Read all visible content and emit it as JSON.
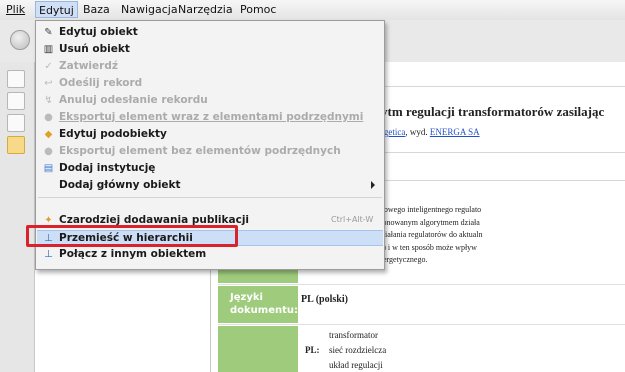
{
  "menubar": {
    "items": [
      "Plik",
      "Edytuj",
      "Baza",
      "Nawigacja",
      "Narzędzia",
      "Pomoc"
    ],
    "active": "Edytuj"
  },
  "edit_menu": {
    "items": [
      {
        "label": "Edytuj obiekt",
        "icon": "edit-icon",
        "enabled": true
      },
      {
        "label": "Usuń obiekt",
        "icon": "trash-icon",
        "enabled": true
      },
      {
        "label": "Zatwierdź",
        "icon": "check-icon",
        "enabled": false
      },
      {
        "label": "Odeślij rekord",
        "icon": "return-icon",
        "enabled": false
      },
      {
        "label": "Anuluj odesłanie rekordu",
        "icon": "cancel-return-icon",
        "enabled": false
      },
      {
        "label": "Eksportuj element wraz z elementami podrzędnymi",
        "icon": "export-icon",
        "enabled": false
      },
      {
        "label": "Edytuj podobiekty",
        "icon": "edit-children-icon",
        "enabled": true
      },
      {
        "label": "Eksportuj element bez elementów podrzędnych",
        "icon": "export-icon",
        "enabled": false
      },
      {
        "label": "Dodaj instytucję",
        "icon": "institution-icon",
        "enabled": true
      },
      {
        "label": "Dodaj główny obiekt",
        "icon": "none",
        "enabled": true,
        "submenu": true
      },
      {
        "label": "Czarodziej dodawania publikacji",
        "icon": "wizard-icon",
        "enabled": true,
        "shortcut": "Ctrl+Alt-W"
      },
      {
        "label": "Przemieść w hierarchii",
        "icon": "hierarchy-icon",
        "enabled": true,
        "highlighted": true
      },
      {
        "label": "Połącz z innym obiektem",
        "icon": "link-icon",
        "enabled": true
      }
    ]
  },
  "content": {
    "title": "ytm regulacji transformatorów zasilając",
    "byline_prefix": "rgetica",
    "byline_mid": ", wyd. ",
    "byline_publisher": "ENERGA SA",
    "abstract_lines": [
      "tykule opisano przykład nowego inteligentnego regulato",
      "rmatorów 110/SN, z proponowanym algorytmem działa",
      "ostosowanie algorytmu działania regulatorów do aktualn",
      "nego (np. lawina napięcia) i w ten sposób może wpływ",
      "bezpieczeństwa elektroenergetycznego."
    ],
    "lang_label_line1": "Języki",
    "lang_label_line2": "dokumentu:",
    "lang_value": "PL (polski)",
    "kw_prefix": "PL:",
    "keywords": [
      "transformator",
      "sieć rozdzielcza",
      "układ regulacji"
    ]
  },
  "colors": {
    "label_bg": "#9ecb7c",
    "highlight": "#cddff6",
    "annotation": "#d8222c"
  }
}
